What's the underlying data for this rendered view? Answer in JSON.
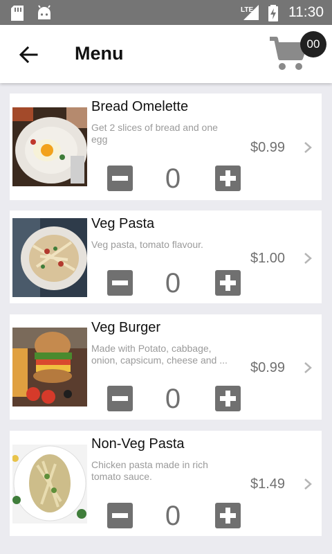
{
  "status_bar": {
    "time": "11:30",
    "network": "LTE"
  },
  "header": {
    "title": "Menu",
    "cart_count": "00"
  },
  "colors": {
    "status_bar": "#757575",
    "background": "#ebebf0",
    "stepper": "#707070",
    "badge": "#212121"
  },
  "items": [
    {
      "name": "Bread Omelette",
      "description": "Get 2 slices of bread and one egg",
      "price": "$0.99",
      "quantity": "0",
      "image_icon": "bread-omelette-photo"
    },
    {
      "name": "Veg Pasta",
      "description": "Veg pasta, tomato flavour.",
      "price": "$1.00",
      "quantity": "0",
      "image_icon": "veg-pasta-photo"
    },
    {
      "name": "Veg Burger",
      "description": "Made with Potato, cabbage, onion, capsicum, cheese and ...",
      "price": "$0.99",
      "quantity": "0",
      "image_icon": "veg-burger-photo"
    },
    {
      "name": "Non-Veg Pasta",
      "description": "Chicken pasta made in rich tomato sauce.",
      "price": "$1.49",
      "quantity": "0",
      "image_icon": "non-veg-pasta-photo"
    }
  ]
}
